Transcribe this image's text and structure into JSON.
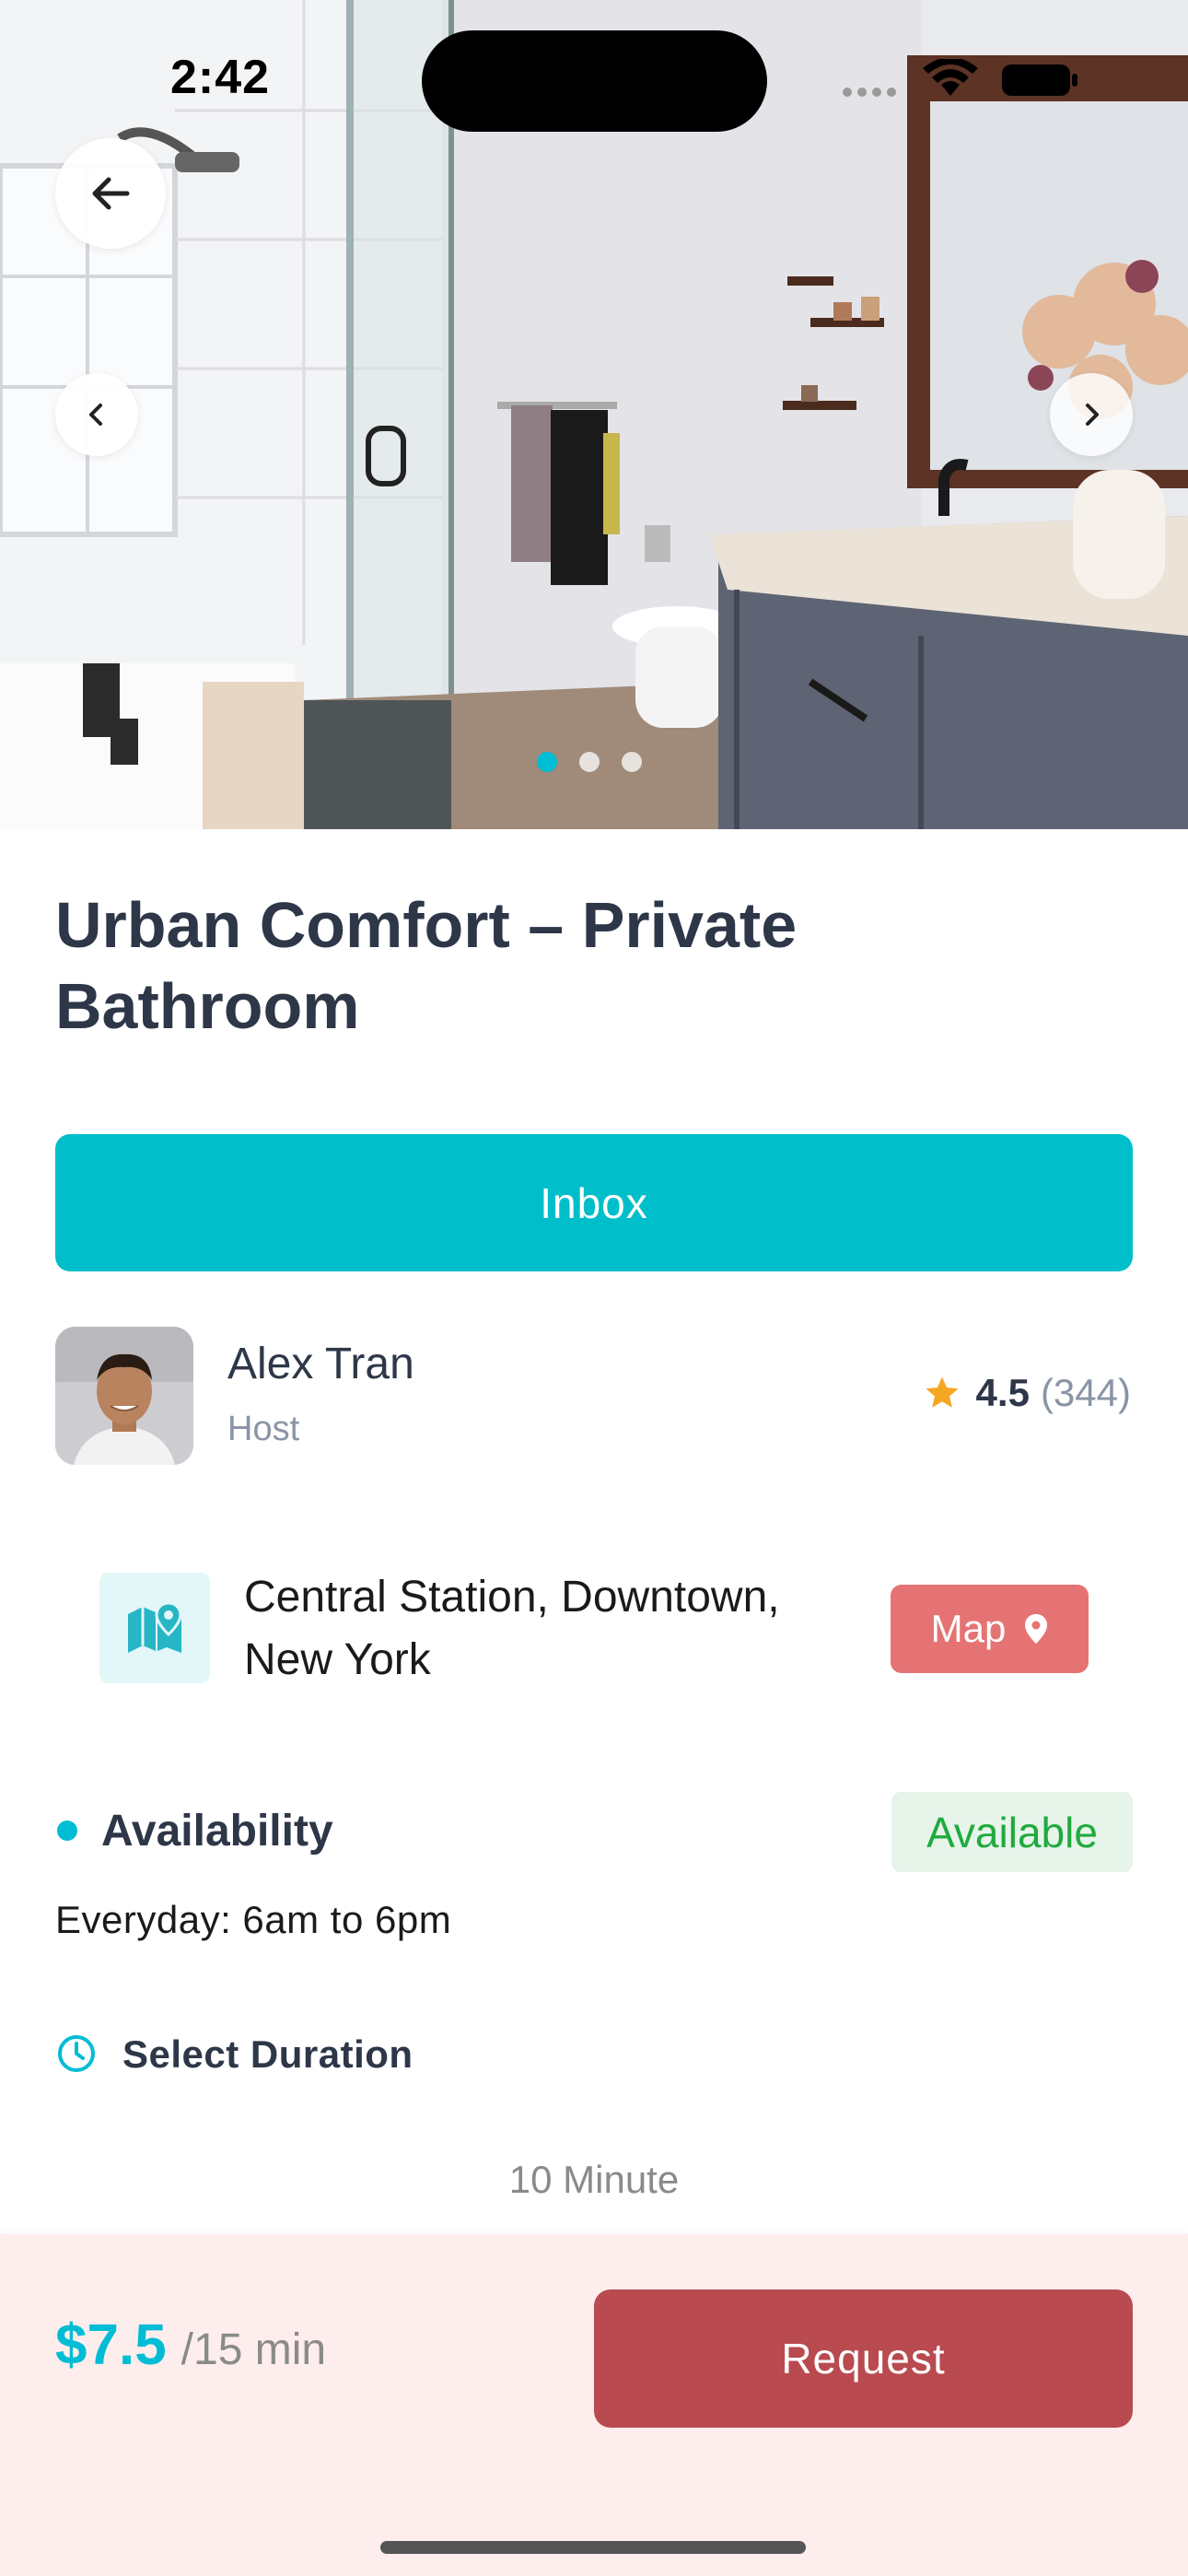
{
  "status_bar": {
    "time": "2:42"
  },
  "listing": {
    "title": "Urban Comfort – Private Bathroom",
    "photo_count": 3,
    "active_photo": 1
  },
  "actions": {
    "inbox_label": "Inbox",
    "map_label": "Map",
    "request_label": "Request"
  },
  "host": {
    "name": "Alex Tran",
    "role": "Host",
    "rating": "4.5",
    "review_count": "(344)"
  },
  "location": {
    "address_line1": "Central Station, Downtown,",
    "address_line2": "New York"
  },
  "availability": {
    "label": "Availability",
    "status": "Available",
    "hours": "Everyday: 6am to 6pm"
  },
  "duration": {
    "label": "Select Duration",
    "value": "10 Minute"
  },
  "pricing": {
    "amount": "$7.5",
    "unit": "/15 min"
  },
  "icons": {
    "back": "arrow-left-icon",
    "prev": "chevron-left-icon",
    "next": "chevron-right-icon",
    "star": "star-icon",
    "location": "map-pin-icon",
    "clock": "clock-icon"
  },
  "colors": {
    "accent": "#00bcd4",
    "inbox": "#00bfca",
    "map_button": "#e57373",
    "request_button": "#b94a4f",
    "available_text": "#1faa3d",
    "star": "#f5a623",
    "bottom_bar": "#fdeded"
  }
}
